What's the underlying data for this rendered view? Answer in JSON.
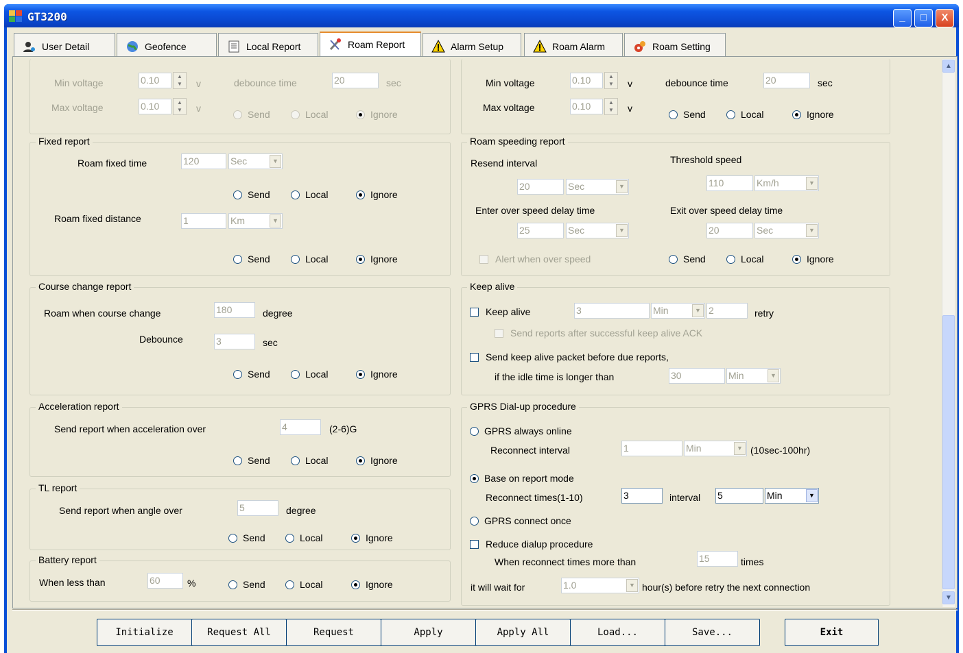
{
  "window": {
    "title": "GT3200",
    "minimize": "_",
    "maximize": "□",
    "close": "X"
  },
  "tabs": [
    {
      "label": "User Detail",
      "icon": "user-gear-icon"
    },
    {
      "label": "Geofence",
      "icon": "globe-icon"
    },
    {
      "label": "Local Report",
      "icon": "document-icon"
    },
    {
      "label": "Roam Report",
      "icon": "roam-tools-icon"
    },
    {
      "label": "Alarm Setup",
      "icon": "warning-icon"
    },
    {
      "label": "Roam Alarm",
      "icon": "warning-icon"
    },
    {
      "label": "Roam Setting",
      "icon": "settings-icon"
    }
  ],
  "active_tab": "Roam Report",
  "common": {
    "send": "Send",
    "local": "Local",
    "ignore": "Ignore",
    "v": "v",
    "sec": "sec",
    "degree": "degree"
  },
  "left": {
    "voltage": {
      "min_label": "Min voltage",
      "min_value": "0.10",
      "max_label": "Max voltage",
      "max_value": "0.10",
      "debounce_label": "debounce time",
      "debounce_value": "20",
      "selected": "Ignore",
      "enabled": false
    },
    "fixed": {
      "title": "Fixed report",
      "time_label": "Roam fixed time",
      "time_value": "120",
      "time_unit": "Sec",
      "dist_label": "Roam fixed distance",
      "dist_value": "1",
      "dist_unit": "Km"
    },
    "course": {
      "title": "Course change report",
      "change_label": "Roam when course change",
      "change_value": "180",
      "debounce_label": "Debounce",
      "debounce_value": "3"
    },
    "accel": {
      "title": "Acceleration report",
      "label": "Send report when acceleration over",
      "value": "4",
      "range": "(2-6)G"
    },
    "tl": {
      "title": "TL report",
      "label": "Send report when angle over",
      "value": "5"
    },
    "battery": {
      "title": "Battery report",
      "label": "When less than",
      "value": "60",
      "unit": "%"
    }
  },
  "right": {
    "voltage": {
      "min_label": "Min voltage",
      "min_value": "0.10",
      "max_label": "Max voltage",
      "max_value": "0.10",
      "debounce_label": "debounce time",
      "debounce_value": "20"
    },
    "speeding": {
      "title": "Roam speeding report",
      "resend_label": "Resend interval",
      "resend_value": "20",
      "resend_unit": "Sec",
      "threshold_label": "Threshold speed",
      "threshold_value": "110",
      "threshold_unit": "Km/h",
      "enter_label": "Enter over speed delay time",
      "enter_value": "25",
      "enter_unit": "Sec",
      "exit_label": "Exit over speed delay time",
      "exit_value": "20",
      "exit_unit": "Sec",
      "alert_label": "Alert when over speed"
    },
    "keepalive": {
      "title": "Keep alive",
      "check_label": "Keep alive",
      "value": "3",
      "unit": "Min",
      "retry_value": "2",
      "retry_label": "retry",
      "ack_label": "Send reports after successful keep alive ACK",
      "due_label": "Send keep alive packet before due reports,",
      "idle_label": "if the idle time is longer than",
      "idle_value": "30",
      "idle_unit": "Min"
    },
    "gprs": {
      "title": "GPRS Dial-up procedure",
      "always_label": "GPRS always online",
      "reconnect_label": "Reconnect interval",
      "reconnect_value": "1",
      "reconnect_unit": "Min",
      "reconnect_range": "(10sec-100hr)",
      "base_label": "Base on report mode",
      "times_label": "Reconnect times(1-10)",
      "times_value": "3",
      "interval_label": "interval",
      "interval_value": "5",
      "interval_unit": "Min",
      "once_label": "GPRS connect once",
      "reduce_label": "Reduce dialup procedure",
      "when_label": "When reconnect times more than",
      "when_value": "15",
      "times_word": "times",
      "wait_label": "it will wait for",
      "wait_value": "1.0",
      "wait_suffix": "hour(s) before retry the next connection"
    }
  },
  "buttons": {
    "initialize": "Initialize",
    "request_all": "Request All",
    "request": "Request",
    "apply": "Apply",
    "apply_all": "Apply All",
    "load": "Load...",
    "save": "Save...",
    "exit": "Exit"
  }
}
